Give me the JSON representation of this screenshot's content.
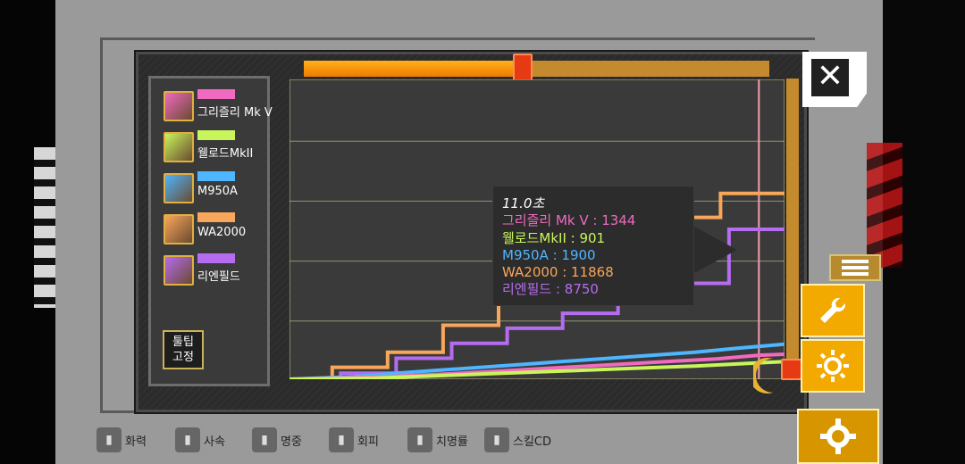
{
  "legend": {
    "items": [
      {
        "name": "그리즐리 Mk V",
        "color": "#f06ac0"
      },
      {
        "name": "웰로드MkII",
        "color": "#c8f55a"
      },
      {
        "name": "M950A",
        "color": "#4db6ff"
      },
      {
        "name": "WA2000",
        "color": "#f8a65a"
      },
      {
        "name": "리엔필드",
        "color": "#b56cf0"
      }
    ],
    "tooltip_fix_button": "툴팁\n고정"
  },
  "scrubber": {
    "position": 0.47
  },
  "vertical_scroll": {
    "position": 1.0
  },
  "tooltip": {
    "time": "11.0초",
    "lines": [
      {
        "text": "그리즐리 Mk V : 1344",
        "color": "#f06ac0"
      },
      {
        "text": "웰로드MkII : 901",
        "color": "#c8f55a"
      },
      {
        "text": "M950A : 1900",
        "color": "#4db6ff"
      },
      {
        "text": "WA2000 : 11868",
        "color": "#f8a65a"
      },
      {
        "text": "리엔필드 : 8750",
        "color": "#b56cf0"
      }
    ]
  },
  "close_button": {
    "icon": "close-icon"
  },
  "side_buttons": [
    {
      "icon": "wrench-icon"
    },
    {
      "icon": "sun-icon"
    }
  ],
  "bottom_stats": [
    {
      "label": "화력",
      "icon": "bullet-icon"
    },
    {
      "label": "사속",
      "icon": "hourglass-icon"
    },
    {
      "label": "명중",
      "icon": "crosshair-icon"
    },
    {
      "label": "회피",
      "icon": "dodge-icon"
    },
    {
      "label": "치명률",
      "icon": "percent-icon"
    },
    {
      "label": "스킬CD",
      "icon": "skill-icon"
    }
  ],
  "chart_data": {
    "type": "line",
    "xlabel": "",
    "ylabel": "",
    "cursor_x": 11.0,
    "xlim": [
      0,
      11.6
    ],
    "ylim": [
      0,
      15000
    ],
    "grid": true,
    "series": [
      {
        "name": "WA2000",
        "color": "#f8a65a",
        "x": [
          0,
          1.0,
          1.0,
          2.3,
          2.3,
          3.6,
          3.6,
          4.9,
          4.9,
          6.2,
          6.2,
          7.5,
          7.5,
          8.8,
          8.8,
          10.1,
          10.1,
          11.6
        ],
        "y": [
          0,
          0,
          600,
          600,
          1350,
          1350,
          2700,
          2700,
          4050,
          4050,
          5400,
          5400,
          6750,
          6750,
          8100,
          8100,
          9300,
          9300
        ]
      },
      {
        "name": "리엔필드",
        "color": "#b56cf0",
        "x": [
          0,
          1.2,
          1.2,
          2.5,
          2.5,
          3.8,
          3.8,
          5.1,
          5.1,
          6.4,
          6.4,
          7.7,
          7.7,
          9.0,
          9.0,
          10.3,
          10.3,
          11.6
        ],
        "y": [
          0,
          0,
          300,
          300,
          1050,
          1050,
          1800,
          1800,
          2550,
          2550,
          3300,
          3300,
          4050,
          4050,
          4800,
          4800,
          7500,
          7500
        ]
      },
      {
        "name": "M950A",
        "color": "#4db6ff",
        "x": [
          0,
          1.5,
          2.5,
          3.5,
          4.5,
          5.5,
          6.5,
          7.5,
          8.5,
          9.5,
          10.5,
          11.6
        ],
        "y": [
          0,
          120,
          300,
          450,
          600,
          750,
          900,
          1050,
          1200,
          1350,
          1550,
          1750
        ]
      },
      {
        "name": "그리즐리 Mk V",
        "color": "#f06ac0",
        "x": [
          0,
          1.8,
          3,
          4,
          5,
          6,
          7,
          8,
          9,
          10,
          11,
          11.6
        ],
        "y": [
          0,
          90,
          190,
          300,
          420,
          540,
          660,
          780,
          900,
          1020,
          1200,
          1250
        ]
      },
      {
        "name": "웰로드MkII",
        "color": "#c8f55a",
        "x": [
          0,
          2.0,
          3.5,
          5,
          6.5,
          8,
          9.5,
          11,
          11.6
        ],
        "y": [
          0,
          60,
          180,
          300,
          420,
          540,
          660,
          820,
          880
        ]
      }
    ]
  }
}
